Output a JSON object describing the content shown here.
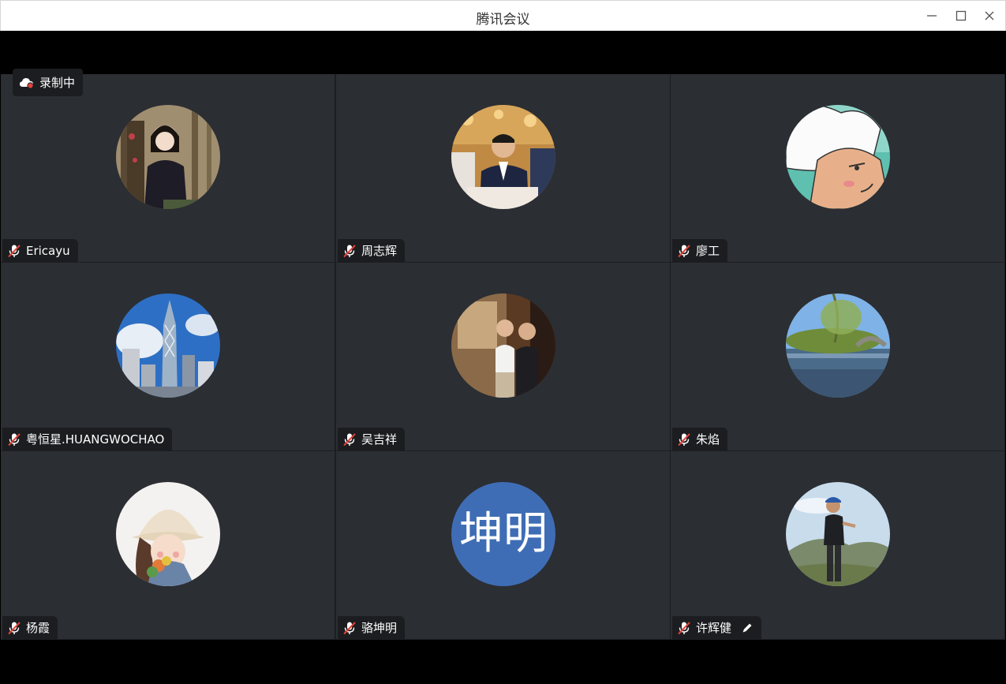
{
  "window": {
    "title": "腾讯会议",
    "controls": [
      "minimize-icon",
      "maximize-icon",
      "close-icon"
    ]
  },
  "recording": {
    "label": "录制中",
    "icon": "cloud-record-icon"
  },
  "colors": {
    "tile_background": "#2b2e33",
    "nametag_background": "#1b1d20",
    "avatar_text_background": "#3f6db5",
    "mute_icon": "#e0433a"
  },
  "participants": [
    {
      "name": "Ericayu",
      "muted": true,
      "avatar": "photo-woman-trees"
    },
    {
      "name": "周志辉",
      "muted": true,
      "avatar": "photo-man-suit-conference"
    },
    {
      "name": "廖工",
      "muted": true,
      "avatar": "cartoon-white-hair"
    },
    {
      "name": "粤恒星.HUANGWOCHAO",
      "muted": true,
      "avatar": "photo-skyscraper"
    },
    {
      "name": "吴吉祥",
      "muted": true,
      "avatar": "photo-two-men"
    },
    {
      "name": "朱焰",
      "muted": true,
      "avatar": "photo-lake-bridge"
    },
    {
      "name": "杨霞",
      "muted": true,
      "avatar": "cartoon-girl-hat"
    },
    {
      "name": "骆坤明",
      "muted": true,
      "avatar_text": "坤明"
    },
    {
      "name": "许辉健",
      "muted": true,
      "avatar": "photo-man-hillside",
      "icon": "pencil-icon"
    }
  ]
}
